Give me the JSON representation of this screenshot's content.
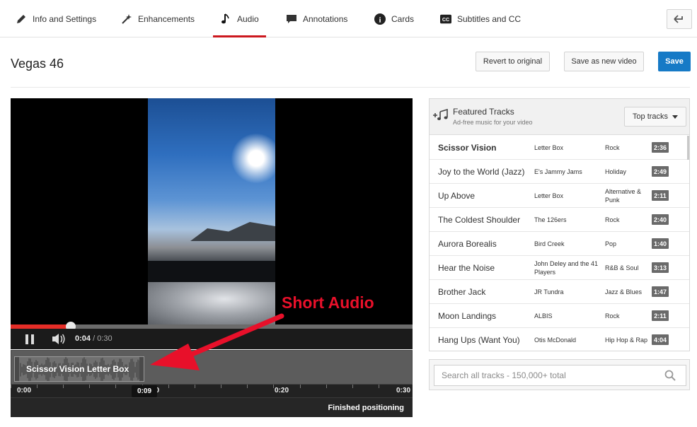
{
  "nav": {
    "tabs": [
      {
        "label": "Info and Settings"
      },
      {
        "label": "Enhancements"
      },
      {
        "label": "Audio"
      },
      {
        "label": "Annotations"
      },
      {
        "label": "Cards"
      },
      {
        "label": "Subtitles and CC"
      }
    ],
    "active_tab": "Audio",
    "cards_icon_glyph": "i",
    "cc_icon_glyph": "CC"
  },
  "header": {
    "title": "Vegas 46",
    "revert_label": "Revert to original",
    "save_new_label": "Save as new video",
    "save_label": "Save"
  },
  "player": {
    "current_time": "0:04",
    "separator": " / ",
    "total_time": "0:30",
    "progress": 0.15
  },
  "timeline": {
    "clip_label": "Scissor Vision Letter Box",
    "ticks": [
      "0:00",
      "0:10",
      "0:20",
      "0:30"
    ],
    "marker_time": "0:09",
    "status": "Finished positioning"
  },
  "annotation": {
    "text": "Short Audio",
    "color": "#e8102a"
  },
  "tracks_panel": {
    "title": "Featured Tracks",
    "subtitle": "Ad-free music for your video",
    "sort_label": "Top tracks",
    "tracks": [
      {
        "name": "Scissor Vision",
        "artist": "Letter Box",
        "genre": "Rock",
        "duration": "2:36"
      },
      {
        "name": "Joy to the World (Jazz)",
        "artist": "E's Jammy Jams",
        "genre": "Holiday",
        "duration": "2:49"
      },
      {
        "name": "Up Above",
        "artist": "Letter Box",
        "genre": "Alternative & Punk",
        "duration": "2:11"
      },
      {
        "name": "The Coldest Shoulder",
        "artist": "The 126ers",
        "genre": "Rock",
        "duration": "2:40"
      },
      {
        "name": "Aurora Borealis",
        "artist": "Bird Creek",
        "genre": "Pop",
        "duration": "1:40"
      },
      {
        "name": "Hear the Noise",
        "artist": "John Deley and the 41 Players",
        "genre": "R&B & Soul",
        "duration": "3:13"
      },
      {
        "name": "Brother Jack",
        "artist": "JR Tundra",
        "genre": "Jazz & Blues",
        "duration": "1:47"
      },
      {
        "name": "Moon Landings",
        "artist": "ALBIS",
        "genre": "Rock",
        "duration": "2:11"
      },
      {
        "name": "Hang Ups (Want You)",
        "artist": "Otis McDonald",
        "genre": "Hip Hop & Rap",
        "duration": "4:04"
      }
    ]
  },
  "search": {
    "placeholder": "Search all tracks - 150,000+ total"
  },
  "colors": {
    "accent_red": "#cc181e",
    "save_blue": "#167ac6",
    "progress_red": "#e52d27"
  }
}
